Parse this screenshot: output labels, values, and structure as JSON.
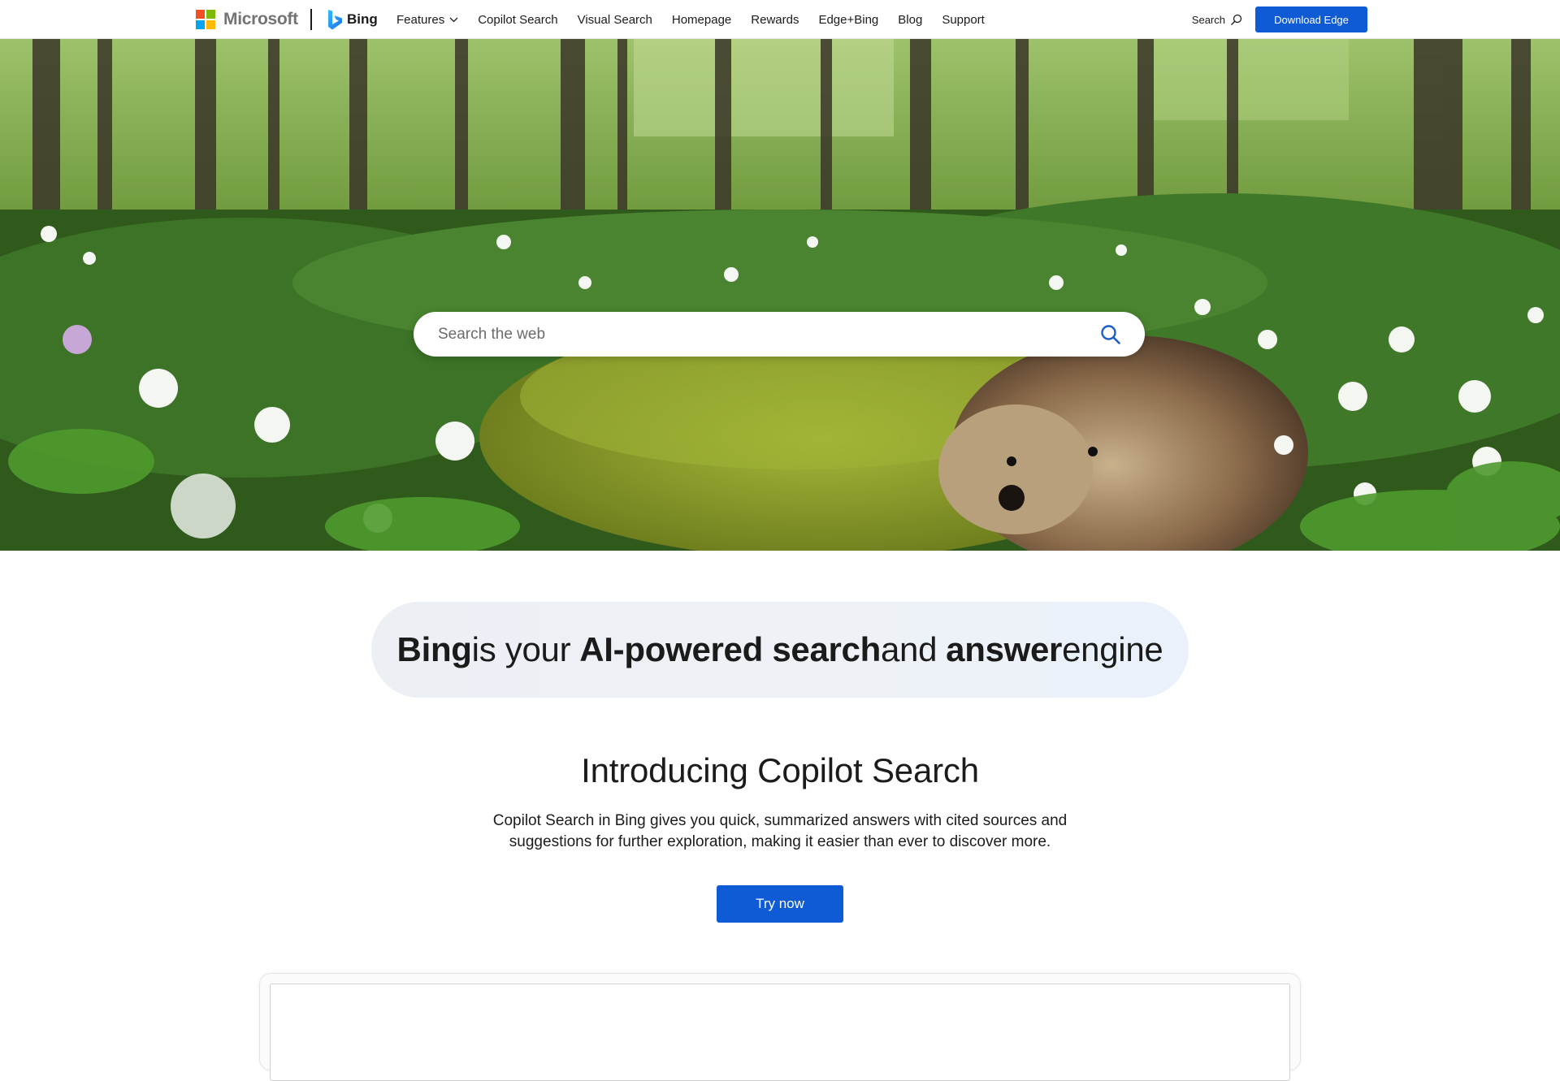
{
  "brand": {
    "microsoft": "Microsoft",
    "bing": "Bing"
  },
  "nav": {
    "items": [
      "Features",
      "Copilot Search",
      "Visual Search",
      "Homepage",
      "Rewards",
      "Edge+Bing",
      "Blog",
      "Support"
    ],
    "search_label": "Search",
    "download_label": "Download Edge"
  },
  "hero": {
    "search_placeholder": "Search the web"
  },
  "tagline": {
    "w1": "Bing",
    "w2": "is your",
    "w3": "AI-powered search",
    "w4": "and",
    "w5": "answer",
    "w6": "engine"
  },
  "intro": {
    "title": "Introducing Copilot Search",
    "description": "Copilot Search in Bing gives you quick, summarized answers with cited sources and suggestions for further exploration, making it easier than ever to discover more.",
    "cta": "Try now"
  },
  "colors": {
    "accent": "#0f5bd5",
    "text": "#1b1b1b"
  },
  "icons": {
    "nav_search": "search-icon",
    "hero_search": "search-icon",
    "features_menu": "chevron-down-icon"
  }
}
